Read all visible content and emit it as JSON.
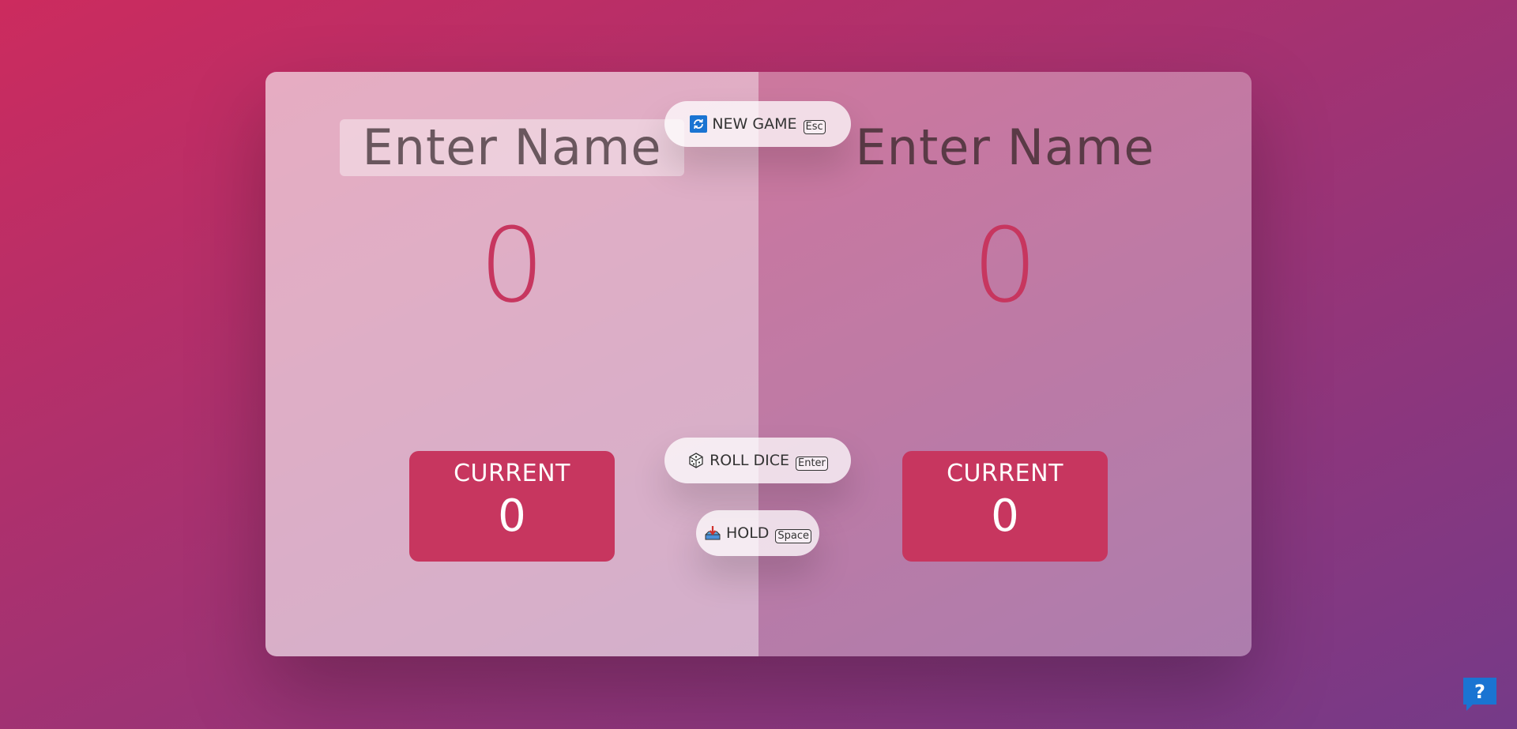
{
  "players": [
    {
      "name_placeholder": "Enter Name",
      "score": "0",
      "current_label": "CURRENT",
      "current_score": "0"
    },
    {
      "name_placeholder": "Enter Name",
      "score": "0",
      "current_label": "CURRENT",
      "current_score": "0"
    }
  ],
  "buttons": {
    "new_game": {
      "label": "NEW GAME",
      "key": "Esc",
      "icon": "refresh-icon"
    },
    "roll_dice": {
      "label": "ROLL DICE",
      "key": "Enter",
      "icon": "dice-icon"
    },
    "hold": {
      "label": "HOLD",
      "key": "Space",
      "icon": "inbox-tray-icon"
    }
  },
  "help": {
    "label": "?",
    "icon": "help-icon"
  },
  "colors": {
    "accent": "#c7365f",
    "gradient_start": "#cc2b5e",
    "gradient_end": "#753a88",
    "refresh_icon_bg": "#1a74d2",
    "help_icon_bg": "#1a74d2"
  }
}
